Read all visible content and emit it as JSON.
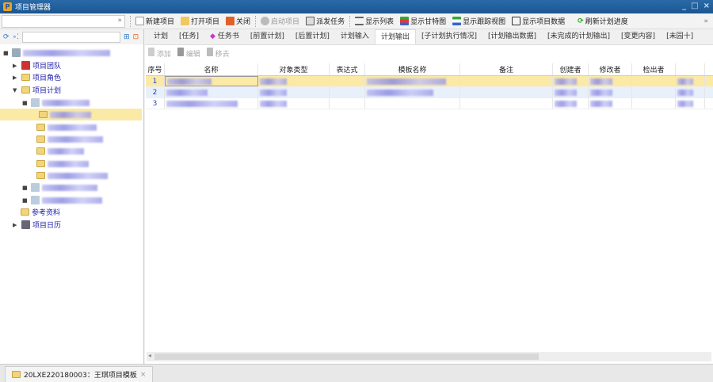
{
  "window": {
    "title": "项目管理器",
    "controls": [
      "minimize",
      "maximize",
      "close"
    ]
  },
  "toolbar": {
    "combo_value": "",
    "items": [
      {
        "label": "新建项目",
        "icon": "new-file-icon",
        "enabled": true
      },
      {
        "label": "打开项目",
        "icon": "folder-open-icon",
        "enabled": true
      },
      {
        "label": "关闭",
        "icon": "close-x-icon",
        "enabled": true
      },
      {
        "label": "启动项目",
        "icon": "start-icon",
        "enabled": false
      },
      {
        "label": "派发任务",
        "icon": "dispatch-icon",
        "enabled": true
      },
      {
        "label": "显示列表",
        "icon": "list-icon",
        "enabled": true
      },
      {
        "label": "显示甘特图",
        "icon": "gantt-icon",
        "enabled": true
      },
      {
        "label": "显示跟踪视图",
        "icon": "tracking-icon",
        "enabled": true
      },
      {
        "label": "显示项目数据",
        "icon": "data-icon",
        "enabled": true
      },
      {
        "label": "刷新计划进度",
        "icon": "refresh-icon",
        "enabled": true
      }
    ]
  },
  "tree": {
    "search_value": "",
    "items": [
      {
        "label": "项目团队"
      },
      {
        "label": "项目角色"
      },
      {
        "label": "项目计划"
      },
      {
        "label": "参考资料"
      },
      {
        "label": "项目日历"
      }
    ]
  },
  "tabs": [
    {
      "label": "计划"
    },
    {
      "label": "[任务]"
    },
    {
      "label": "任务书"
    },
    {
      "label": "[前置计划]"
    },
    {
      "label": "[后置计划]"
    },
    {
      "label": "计划输入"
    },
    {
      "label": "计划输出",
      "active": true
    },
    {
      "label": "[子计划执行情况]"
    },
    {
      "label": "[计划输出数据]"
    },
    {
      "label": "[未完成的计划输出]"
    },
    {
      "label": "[变更内容]"
    },
    {
      "label": "[未园十]"
    }
  ],
  "subtoolbar": {
    "add": "添加",
    "edit": "编辑",
    "delete": "移去"
  },
  "grid": {
    "columns": [
      "序号",
      "名称",
      "对象类型",
      "表达式",
      "模板名称",
      "备注",
      "创建者",
      "修改者",
      "检出者"
    ],
    "rows": [
      {
        "num": "1"
      },
      {
        "num": "2"
      },
      {
        "num": "3"
      }
    ]
  },
  "bottom_tab": {
    "label": "20LXE220180003：王琪项目模板"
  }
}
